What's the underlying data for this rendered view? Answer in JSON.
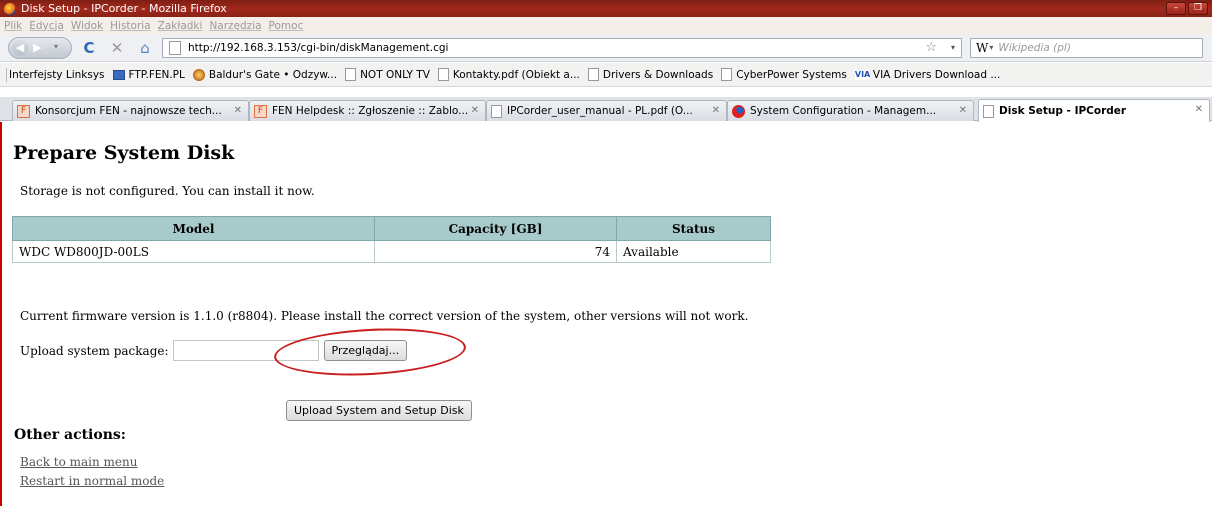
{
  "window": {
    "title": "Disk Setup - IPCorder - Mozilla Firefox",
    "minimize": "–",
    "restore": "❐"
  },
  "menu": [
    "Plik",
    "Edycja",
    "Widok",
    "Historia",
    "Zakładki",
    "Narzędzia",
    "Pomoc"
  ],
  "nav": {
    "url": "http://192.168.3.153/cgi-bin/diskManagement.cgi",
    "search_engine": "W",
    "search_placeholder": "Wikipedia (pl)"
  },
  "bookmarks": [
    {
      "label": "Interfejsty Linksys",
      "icon": "separator-icon"
    },
    {
      "label": "FTP.FEN.PL",
      "icon": "monitor-icon"
    },
    {
      "label": "Baldur's Gate • Odzyw...",
      "icon": "shield-icon"
    },
    {
      "label": "NOT ONLY TV",
      "icon": "page-icon"
    },
    {
      "label": "Kontakty.pdf (Obiekt a...",
      "icon": "page-icon"
    },
    {
      "label": "Drivers & Downloads",
      "icon": "page-icon"
    },
    {
      "label": "CyberPower Systems",
      "icon": "page-icon"
    },
    {
      "label": "VIA Drivers Download ...",
      "icon": "via-icon"
    }
  ],
  "tabs": [
    {
      "label": "Konsorcjum FEN - najnowsze tech...",
      "icon": "fen-icon",
      "active": false
    },
    {
      "label": "FEN Helpdesk :: Zgłoszenie :: Zablo...",
      "icon": "fen-icon",
      "active": false
    },
    {
      "label": "IPCorder_user_manual - PL.pdf (O...",
      "icon": "page-icon",
      "active": false
    },
    {
      "label": "System Configuration - Managem...",
      "icon": "system-icon",
      "active": false
    },
    {
      "label": "Disk Setup - IPCorder",
      "icon": "page-icon",
      "active": true
    }
  ],
  "page": {
    "heading": "Prepare System Disk",
    "status_message": "Storage is not configured. You can install it now.",
    "table": {
      "headers": [
        "Model",
        "Capacity [GB]",
        "Status"
      ],
      "rows": [
        [
          "WDC WD800JD-00LS",
          "74",
          "Available"
        ]
      ]
    },
    "firmware_message": "Current firmware version is 1.1.0 (r8804). Please install the correct version of the system, other versions will not work.",
    "upload_label": "Upload system package:",
    "browse_button": "Przeglądaj...",
    "setup_button": "Upload System and Setup Disk",
    "other_actions_heading": "Other actions:",
    "links": [
      "Back to main menu",
      "Restart in normal mode"
    ]
  },
  "colors": {
    "table_header": "#a7cbca",
    "annotation_circle": "#c81e1e",
    "titlebar": "#a3281b"
  }
}
